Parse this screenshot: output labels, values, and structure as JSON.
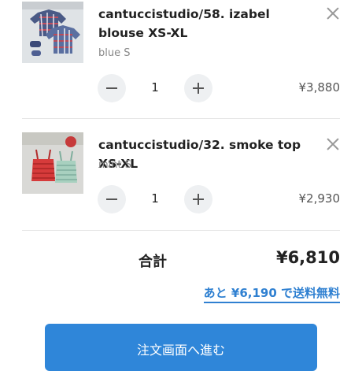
{
  "cart": {
    "items": [
      {
        "name": "cantuccistudio/58. izabel blouse XS-XL",
        "variant": "blue S",
        "quantity": "1",
        "price": "¥3,880"
      },
      {
        "name": "cantuccistudio/32. smoke top XS-XL",
        "variant": "mint S",
        "quantity": "1",
        "price": "¥2,930"
      }
    ],
    "total_label": "合計",
    "total_value": "¥6,810",
    "free_shipping_note": "あと ¥6,190 で送料無料",
    "checkout_label": "注文画面へ進む"
  },
  "colors": {
    "accent": "#2f86d9",
    "link": "#2f80d1",
    "stepper_bg": "#eef0f2"
  }
}
